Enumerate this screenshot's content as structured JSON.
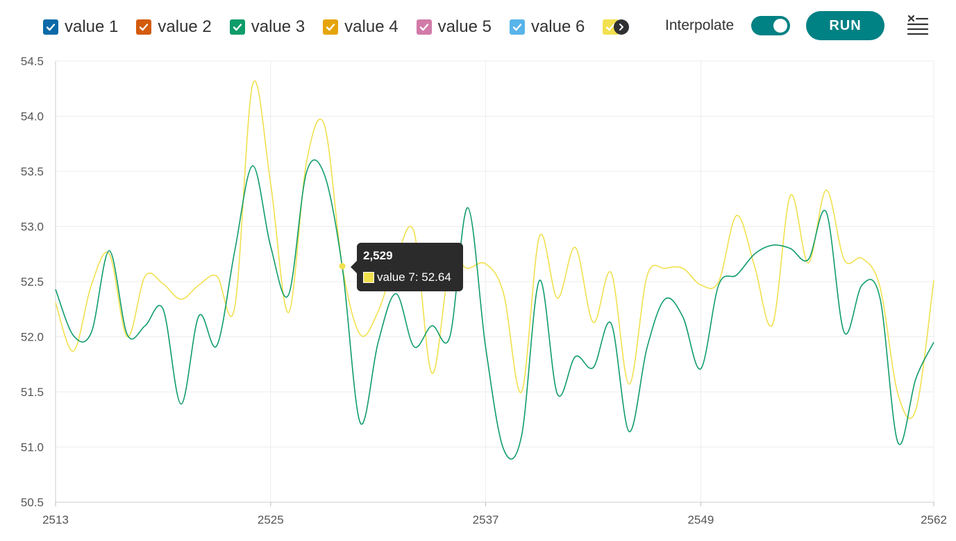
{
  "legend": {
    "items": [
      {
        "label": "value 1",
        "color": "#0a6aa7"
      },
      {
        "label": "value 2",
        "color": "#d35b0a"
      },
      {
        "label": "value 3",
        "color": "#0f9c6a"
      },
      {
        "label": "value 4",
        "color": "#e5a50a"
      },
      {
        "label": "value 5",
        "color": "#d27aa8"
      },
      {
        "label": "value 6",
        "color": "#58b4e9"
      }
    ],
    "partial_color": "#f1e04e"
  },
  "controls": {
    "interpolate_label": "Interpolate",
    "interpolate_on": true,
    "toggle_color": "#008184",
    "run_label": "RUN",
    "run_color": "#008184"
  },
  "tooltip": {
    "title": "2,529",
    "series": "value 7",
    "value": "52.64",
    "text": "value 7: 52.64",
    "color": "#f1e04e"
  },
  "chart_data": {
    "type": "line",
    "xlim": [
      2513,
      2562
    ],
    "ylim": [
      50.5,
      54.5
    ],
    "yticks": [
      "50.5",
      "51.0",
      "51.5",
      "52.0",
      "52.5",
      "53.0",
      "53.5",
      "54.0",
      "54.5"
    ],
    "xticks": [
      "2513",
      "2525",
      "2537",
      "2549",
      "2562"
    ],
    "xtick_values": [
      2513,
      2525,
      2537,
      2549,
      2562
    ],
    "grid": true,
    "series": [
      {
        "name": "value 3",
        "color": "#0f9c6a",
        "points": [
          [
            2513,
            52.43
          ],
          [
            2514,
            52.01
          ],
          [
            2515,
            52.04
          ],
          [
            2516,
            52.78
          ],
          [
            2517,
            52.02
          ],
          [
            2518,
            52.1
          ],
          [
            2519,
            52.25
          ],
          [
            2520,
            51.39
          ],
          [
            2521,
            52.19
          ],
          [
            2522,
            51.92
          ],
          [
            2523,
            52.78
          ],
          [
            2524,
            53.55
          ],
          [
            2525,
            52.82
          ],
          [
            2526,
            52.38
          ],
          [
            2527,
            53.49
          ],
          [
            2528,
            53.47
          ],
          [
            2529,
            52.63
          ],
          [
            2530,
            51.22
          ],
          [
            2531,
            51.95
          ],
          [
            2532,
            52.39
          ],
          [
            2533,
            51.91
          ],
          [
            2534,
            52.1
          ],
          [
            2535,
            52.0
          ],
          [
            2536,
            53.17
          ],
          [
            2537,
            51.9
          ],
          [
            2538,
            50.98
          ],
          [
            2539,
            51.1
          ],
          [
            2540,
            52.51
          ],
          [
            2541,
            51.48
          ],
          [
            2542,
            51.82
          ],
          [
            2543,
            51.72
          ],
          [
            2544,
            52.12
          ],
          [
            2545,
            51.14
          ],
          [
            2546,
            51.9
          ],
          [
            2547,
            52.34
          ],
          [
            2548,
            52.18
          ],
          [
            2549,
            51.71
          ],
          [
            2550,
            52.47
          ],
          [
            2551,
            52.56
          ],
          [
            2552,
            52.75
          ],
          [
            2553,
            52.83
          ],
          [
            2554,
            52.8
          ],
          [
            2555,
            52.7
          ],
          [
            2556,
            53.13
          ],
          [
            2557,
            52.04
          ],
          [
            2558,
            52.47
          ],
          [
            2559,
            52.35
          ],
          [
            2560,
            51.04
          ],
          [
            2561,
            51.62
          ],
          [
            2562,
            51.95
          ]
        ]
      },
      {
        "name": "value 7",
        "color": "#f1e04e",
        "points": [
          [
            2513,
            52.31
          ],
          [
            2514,
            51.87
          ],
          [
            2515,
            52.47
          ],
          [
            2516,
            52.75
          ],
          [
            2517,
            52.0
          ],
          [
            2518,
            52.55
          ],
          [
            2519,
            52.48
          ],
          [
            2520,
            52.34
          ],
          [
            2521,
            52.47
          ],
          [
            2522,
            52.55
          ],
          [
            2523,
            52.27
          ],
          [
            2524,
            54.29
          ],
          [
            2525,
            53.39
          ],
          [
            2526,
            52.22
          ],
          [
            2527,
            53.58
          ],
          [
            2528,
            53.92
          ],
          [
            2529,
            52.64
          ],
          [
            2530,
            52.02
          ],
          [
            2531,
            52.23
          ],
          [
            2532,
            52.7
          ],
          [
            2533,
            52.95
          ],
          [
            2534,
            51.67
          ],
          [
            2535,
            52.64
          ],
          [
            2536,
            52.62
          ],
          [
            2537,
            52.66
          ],
          [
            2538,
            52.39
          ],
          [
            2539,
            51.5
          ],
          [
            2540,
            52.91
          ],
          [
            2541,
            52.35
          ],
          [
            2542,
            52.81
          ],
          [
            2543,
            52.13
          ],
          [
            2544,
            52.58
          ],
          [
            2545,
            51.57
          ],
          [
            2546,
            52.55
          ],
          [
            2547,
            52.62
          ],
          [
            2548,
            52.62
          ],
          [
            2549,
            52.47
          ],
          [
            2550,
            52.5
          ],
          [
            2551,
            53.1
          ],
          [
            2552,
            52.64
          ],
          [
            2553,
            52.11
          ],
          [
            2554,
            53.28
          ],
          [
            2555,
            52.67
          ],
          [
            2556,
            53.33
          ],
          [
            2557,
            52.7
          ],
          [
            2558,
            52.71
          ],
          [
            2559,
            52.45
          ],
          [
            2560,
            51.48
          ],
          [
            2561,
            51.34
          ],
          [
            2562,
            52.51
          ]
        ]
      }
    ],
    "highlight": {
      "series": "value 7",
      "x": 2529,
      "y": 52.64
    }
  }
}
